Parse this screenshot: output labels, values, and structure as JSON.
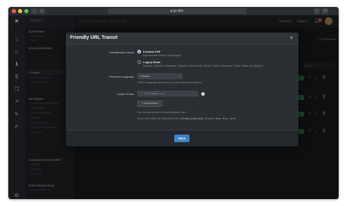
{
  "browser": {
    "url": "gc.dev"
  },
  "app": {
    "title": "System"
  },
  "sidebar": {
    "sections": [
      {
        "title": "OVERVIEW",
        "items": [
          "Dashboard",
          "Stats"
        ]
      },
      {
        "title": "SITE FEATURES",
        "items": [
          "Plugins",
          "Email Templates",
          "SEO & Tools"
        ]
      },
      {
        "title": "SETTINGS",
        "items": [
          "Frontend Configuration",
          "Localization",
          "Posts & Content",
          "Privacy",
          "Email Settings",
          "Login & Registration",
          "Backups"
        ]
      },
      {
        "title": "CONTENT DISCOVERY",
        "items": [
          "Search",
          "Sitemap",
          "Redirects"
        ]
      },
      {
        "title": "SITE PROMOTION",
        "items": [
          "Social Networks"
        ]
      }
    ]
  },
  "topbar": {
    "search_placeholder": "Search for settings, features, etc.",
    "right_link": "Web Site",
    "support_label": "Support",
    "notifications_count": "1"
  },
  "main": {
    "new_label": "+ Create new",
    "filter_placeholder": "Search..."
  },
  "modal": {
    "title": "Friendly URL Transit",
    "transliteration_mode": {
      "label": "Transliteration Mode",
      "options": [
        {
          "title": "Portable PHP",
          "desc": "Experimental. Shown 18 languages",
          "selected": true
        },
        {
          "title": "Legacy Mode",
          "desc": "Russian, Ukrainian, Belarusian, Bulgarian, Macedonian, Greek, Turkish, Romanian, French, Italian and Spanish.",
          "selected": false
        }
      ]
    },
    "preferred_language": {
      "label": "Preferred Language",
      "value": "Russian",
      "help": "Select a language most suited on your community similar to"
    },
    "custom_rules": {
      "label": "Custom Rules",
      "placeholder": "For example, a-to",
      "add_button": "+ Add another",
      "help1": "You can specify your own transliteration rules.",
      "help2_prefix": "Rules must match the following format:",
      "help2_code": "{find}={replace}",
      "help2_suffix": ". Example:",
      "help2_example": "ä=a, ö=o, ü=u;"
    },
    "save_label": "Save",
    "close_label": "×"
  }
}
